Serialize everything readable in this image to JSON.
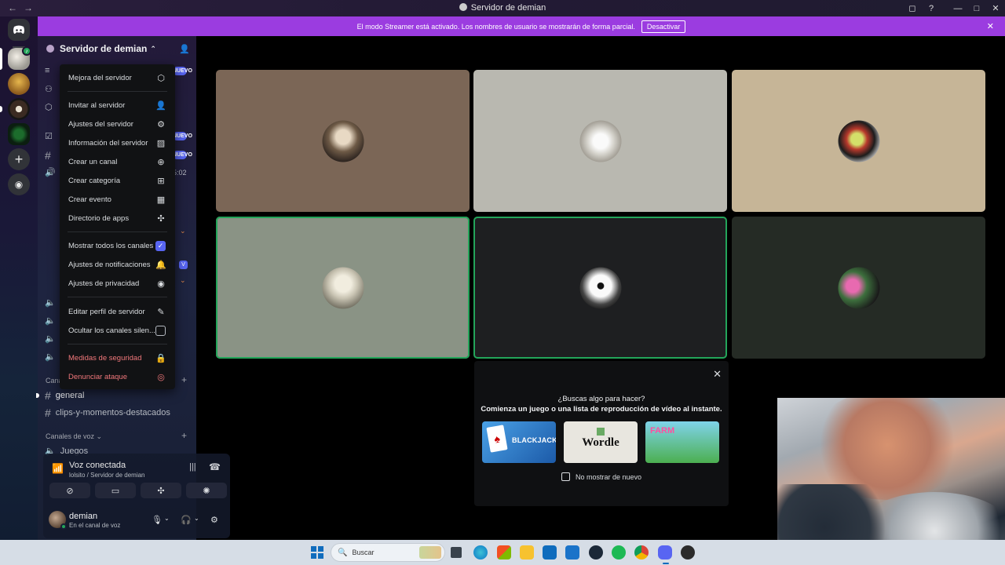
{
  "window": {
    "title": "Servidor de demian",
    "controls": [
      "◻",
      "?",
      "—",
      "□",
      "✕"
    ]
  },
  "banner": {
    "text": "El modo Streamer está activado. Los nombres de usuario se mostrarán de forma parcial.",
    "button": "Desactivar"
  },
  "server": {
    "name": "Servidor de demian"
  },
  "sidebar": {
    "nuevo": "NUEVO",
    "visible_time": "5:02",
    "text_category_partial": "Cana",
    "channels": [
      {
        "name": "general"
      },
      {
        "name": "clips-y-momentos-destacados"
      }
    ],
    "voice_category": "Canales de voz",
    "voice_channels": [
      {
        "name": "Juegos"
      }
    ]
  },
  "menu": {
    "items": [
      {
        "label": "Mejora del servidor",
        "icon": "boost-icon"
      },
      {
        "label": "Invitar al servidor",
        "icon": "invite-icon"
      },
      {
        "label": "Ajustes del servidor",
        "icon": "gear-icon"
      },
      {
        "label": "Información del servidor",
        "icon": "insights-icon"
      },
      {
        "label": "Crear un canal",
        "icon": "plus-circle-icon"
      },
      {
        "label": "Crear categoría",
        "icon": "folder-plus-icon"
      },
      {
        "label": "Crear evento",
        "icon": "calendar-plus-icon"
      },
      {
        "label": "Directorio de apps",
        "icon": "apps-icon"
      },
      {
        "label": "Mostrar todos los canales",
        "icon": "checkbox-on"
      },
      {
        "label": "Ajustes de notificaciones",
        "icon": "bell-icon"
      },
      {
        "label": "Ajustes de privacidad",
        "icon": "shield-icon"
      },
      {
        "label": "Editar perfil de servidor",
        "icon": "pencil-icon"
      },
      {
        "label": "Ocultar los canales silen...",
        "icon": "checkbox-off"
      },
      {
        "label": "Medidas de seguridad",
        "icon": "lock-icon"
      },
      {
        "label": "Denunciar ataque",
        "icon": "alert-icon"
      }
    ]
  },
  "voice": {
    "status": "Voz conectada",
    "location": "lolsito / Servidor de demian"
  },
  "user": {
    "name": "demian",
    "status": "En el canal de voz"
  },
  "activity": {
    "question": "¿Buscas algo para hacer?",
    "prompt": "Comienza un juego o una lista de reproducción de vídeo al instante.",
    "games": [
      "BLACKJACK",
      "Wordle",
      "FARM"
    ],
    "dont_show": "No mostrar de nuevo"
  },
  "taskbar": {
    "search_placeholder": "Buscar"
  },
  "colors": {
    "banner": "#9b3ce0",
    "speaking": "#23a55a",
    "brand": "#5865f2",
    "danger": "#f1787b"
  }
}
